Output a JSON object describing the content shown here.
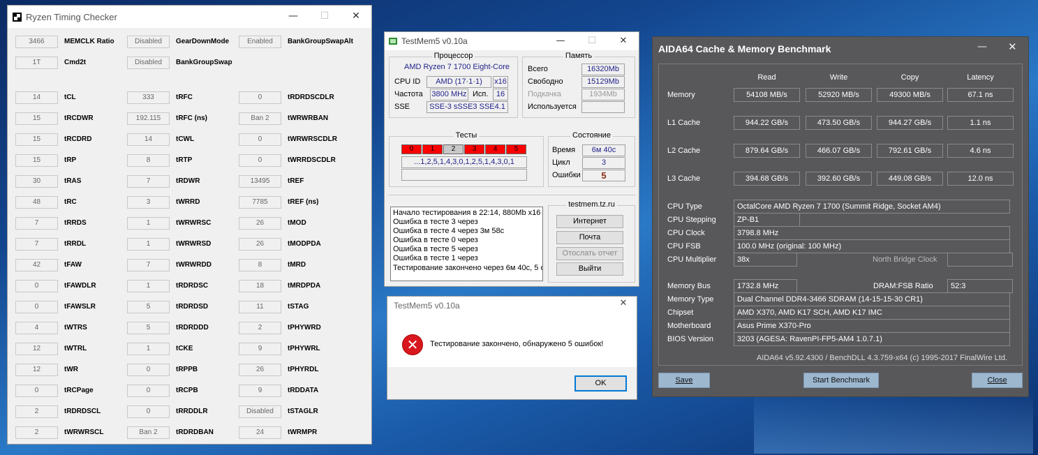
{
  "rtc": {
    "title": "Ryzen Timing Checker",
    "top": [
      {
        "v1": "3466",
        "l1": "MEMCLK Ratio",
        "v2": "Disabled",
        "l2": "GearDownMode",
        "v3": "Enabled",
        "l3": "BankGroupSwapAlt"
      },
      {
        "v1": "1T",
        "l1": "Cmd2t",
        "v2": "Disabled",
        "l2": "BankGroupSwap"
      }
    ],
    "rows": [
      [
        "14",
        "tCL",
        "333",
        "tRFC",
        "0",
        "tRDRDSCDLR"
      ],
      [
        "15",
        "tRCDWR",
        "192.115",
        "tRFC (ns)",
        "Ban 2",
        "tWRWRBAN"
      ],
      [
        "15",
        "tRCDRD",
        "14",
        "tCWL",
        "0",
        "tWRWRSCDLR"
      ],
      [
        "15",
        "tRP",
        "8",
        "tRTP",
        "0",
        "tWRRDSCDLR"
      ],
      [
        "30",
        "tRAS",
        "7",
        "tRDWR",
        "13495",
        "tREF"
      ],
      [
        "48",
        "tRC",
        "3",
        "tWRRD",
        "7785",
        "tREF (ns)"
      ],
      [
        "7",
        "tRRDS",
        "1",
        "tWRWRSC",
        "26",
        "tMOD"
      ],
      [
        "7",
        "tRRDL",
        "1",
        "tWRWRSD",
        "26",
        "tMODPDA"
      ],
      [
        "42",
        "tFAW",
        "7",
        "tWRWRDD",
        "8",
        "tMRD"
      ],
      [
        "0",
        "tFAWDLR",
        "1",
        "tRDRDSC",
        "18",
        "tMRDPDA"
      ],
      [
        "0",
        "tFAWSLR",
        "5",
        "tRDRDSD",
        "11",
        "tSTAG"
      ],
      [
        "4",
        "tWTRS",
        "5",
        "tRDRDDD",
        "2",
        "tPHYWRD"
      ],
      [
        "12",
        "tWTRL",
        "1",
        "tCKE",
        "9",
        "tPHYWRL"
      ],
      [
        "12",
        "tWR",
        "0",
        "tRPPB",
        "26",
        "tPHYRDL"
      ],
      [
        "0",
        "tRCPage",
        "0",
        "tRCPB",
        "9",
        "tRDDATA"
      ],
      [
        "2",
        "tRDRDSCL",
        "0",
        "tRRDDLR",
        "Disabled",
        "tSTAGLR"
      ],
      [
        "2",
        "tWRWRSCL",
        "Ban 2",
        "tRDRDBAN",
        "24",
        "tWRMPR"
      ]
    ]
  },
  "testmem": {
    "title": "TestMem5 v0.10a",
    "cpu_group": "Процессор",
    "cpu_name": "AMD Ryzen 7 1700 Eight-Core",
    "cpu_id_label": "CPU ID",
    "cpu_id_value": "AMD (17·1·1)",
    "cpu_id_threads": "x16",
    "freq_label": "Частота",
    "freq_value": "3800 MHz",
    "used_label": "Исп.",
    "used_value": "16",
    "sse_label": "SSE",
    "sse_value": "SSE-3 sSSE3 SSE4.1",
    "mem_group": "Память",
    "mem_total_label": "Всего",
    "mem_total_value": "16320Mb",
    "mem_free_label": "Свободно",
    "mem_free_value": "15129Mb",
    "mem_swap_label": "Подкачка",
    "mem_swap_value": "1934Mb",
    "mem_used_label": "Используется",
    "mem_used_value": "",
    "tests_group": "Тесты",
    "tests": [
      {
        "n": "0",
        "fail": true
      },
      {
        "n": "1",
        "fail": true
      },
      {
        "n": "2",
        "fail": false
      },
      {
        "n": "3",
        "fail": true
      },
      {
        "n": "4",
        "fail": true
      },
      {
        "n": "5",
        "fail": true
      }
    ],
    "sequence": "...1,2,5,1,4,3,0,1,2,5,1,4,3,0,1",
    "state_group": "Состояние",
    "time_label": "Время",
    "time_value": "6м 40с",
    "cycle_label": "Цикл",
    "cycle_value": "3",
    "errors_label": "Ошибки",
    "errors_value": "5",
    "log": [
      "Начало тестирования в 22:14, 880Mb x16",
      "Ошибка в тесте 3 через",
      "Ошибка в тесте 4 через 3м 58с",
      "Ошибка в тесте 0 через",
      "Ошибка в тесте 5 через",
      "Ошибка в тесте 1 через",
      "Тестирование закончено через 6м 40с, 5 о"
    ],
    "site": "testmem.tz.ru",
    "btn_internet": "Интернет",
    "btn_mail": "Почта",
    "btn_report": "Отослать отчет",
    "btn_exit": "Выйти"
  },
  "dialog": {
    "title": "TestMem5 v0.10a",
    "message": "Тестирование закончено, обнаружено 5 ошибок!",
    "ok": "OK"
  },
  "aida": {
    "title": "AIDA64 Cache & Memory Benchmark",
    "headers": [
      "Read",
      "Write",
      "Copy",
      "Latency"
    ],
    "bench": [
      {
        "label": "Memory",
        "read": "54108 MB/s",
        "write": "52920 MB/s",
        "copy": "49300 MB/s",
        "latency": "67.1 ns"
      },
      {
        "label": "L1 Cache",
        "read": "944.22 GB/s",
        "write": "473.50 GB/s",
        "copy": "944.27 GB/s",
        "latency": "1.1 ns"
      },
      {
        "label": "L2 Cache",
        "read": "879.64 GB/s",
        "write": "466.07 GB/s",
        "copy": "792.61 GB/s",
        "latency": "4.6 ns"
      },
      {
        "label": "L3 Cache",
        "read": "394.68 GB/s",
        "write": "392.60 GB/s",
        "copy": "449.08 GB/s",
        "latency": "12.0 ns"
      }
    ],
    "cpu_type_label": "CPU Type",
    "cpu_type": "OctalCore AMD Ryzen 7 1700  (Summit Ridge, Socket AM4)",
    "cpu_stepping_label": "CPU Stepping",
    "cpu_stepping": "ZP-B1",
    "cpu_clock_label": "CPU Clock",
    "cpu_clock": "3798.8 MHz",
    "cpu_fsb_label": "CPU FSB",
    "cpu_fsb": "100.0 MHz  (original: 100 MHz)",
    "cpu_mult_label": "CPU Multiplier",
    "cpu_mult": "38x",
    "nb_clock_label": "North Bridge Clock",
    "nb_clock": "",
    "mem_bus_label": "Memory Bus",
    "mem_bus": "1732.8 MHz",
    "dram_fsb_label": "DRAM:FSB Ratio",
    "dram_fsb": "52:3",
    "mem_type_label": "Memory Type",
    "mem_type": "Dual Channel DDR4-3466 SDRAM  (14-15-15-30 CR1)",
    "chipset_label": "Chipset",
    "chipset": "AMD X370, AMD K17 SCH, AMD K17 IMC",
    "mobo_label": "Motherboard",
    "mobo": "Asus Prime X370-Pro",
    "bios_label": "BIOS Version",
    "bios": "3203  (AGESA: RavenPI-FP5-AM4 1.0.7.1)",
    "footer": "AIDA64 v5.92.4300 / BenchDLL 4.3.759-x64  (c) 1995-2017 FinalWire Ltd.",
    "save": "Save",
    "start": "Start Benchmark",
    "close": "Close"
  }
}
